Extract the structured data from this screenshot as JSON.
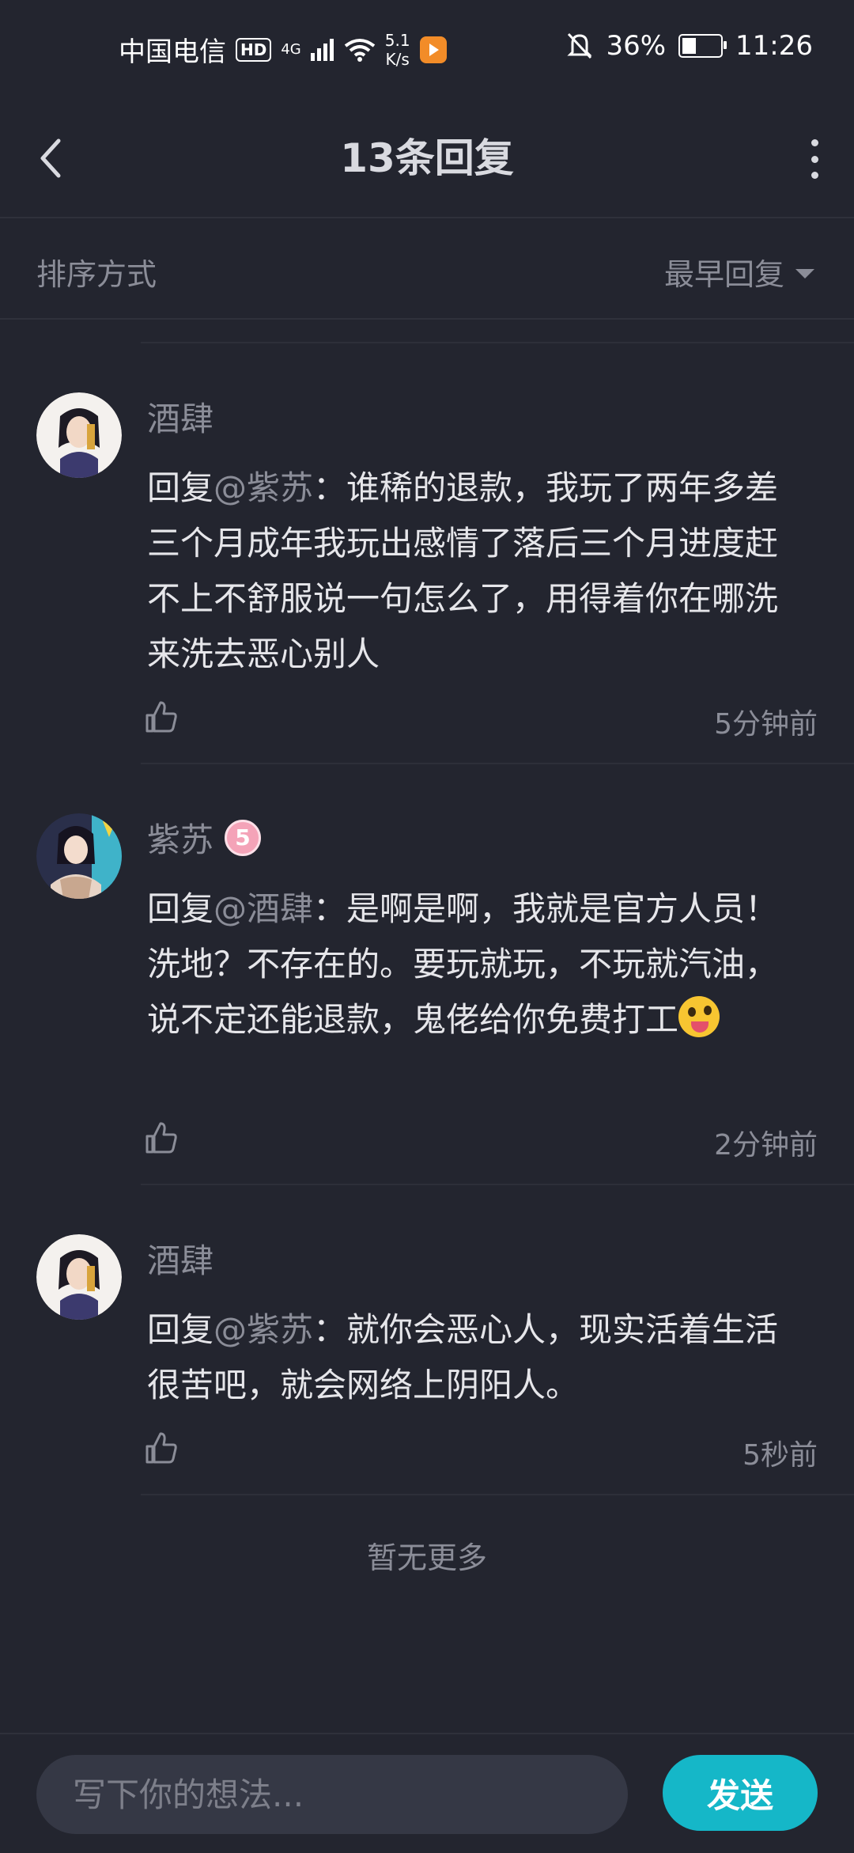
{
  "status_bar": {
    "carrier": "中国电信",
    "hd": "HD",
    "network": "4G",
    "speed_value": "5.1",
    "speed_unit": "K/s",
    "battery": "36%",
    "battery_level": 0.36,
    "time": "11:26"
  },
  "header": {
    "title": "13条回复"
  },
  "sort": {
    "label": "排序方式",
    "value": "最早回复"
  },
  "comments": [
    {
      "user": "酒肆",
      "reply_prefix": "回复",
      "mention": "@紫苏",
      "text": "：谁稀的退款，我玩了两年多差三个月成年我玩出感情了落后三个月进度赶不上不舒服说一句怎么了，用得着你在哪洗来洗去恶心别人",
      "time": "5分钟前"
    },
    {
      "user": "紫苏",
      "badge": "5",
      "reply_prefix": "回复",
      "mention": "@酒肆",
      "text": "：是啊是啊，我就是官方人员！洗地？不存在的。要玩就玩，不玩就汽油，说不定还能退款，鬼佬给你免费打工",
      "time": "2分钟前"
    },
    {
      "user": "酒肆",
      "reply_prefix": "回复",
      "mention": "@紫苏",
      "text": "：就你会恶心人，现实活着生活很苦吧，就会网络上阴阳人。",
      "time": "5秒前"
    }
  ],
  "footer_text": "暂无更多",
  "input": {
    "placeholder": "写下你的想法..."
  },
  "send_label": "发送",
  "colors": {
    "background": "#23252f",
    "accent": "#15b7c8",
    "muted_text": "#8b8d98"
  }
}
